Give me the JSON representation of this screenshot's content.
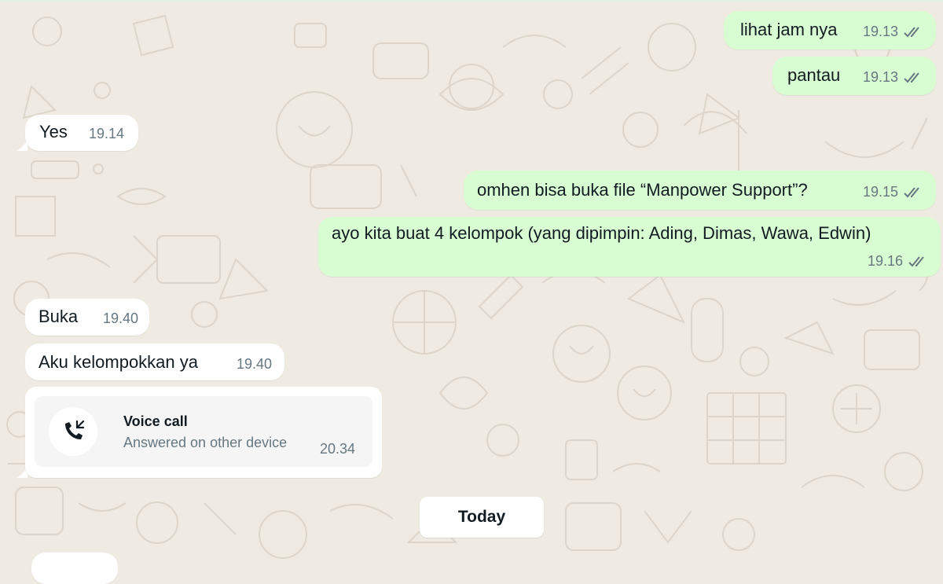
{
  "messages": [
    {
      "id": "m1",
      "direction": "outgoing",
      "text": "lihat jam nya",
      "time": "19.13",
      "status": "read"
    },
    {
      "id": "m2",
      "direction": "outgoing",
      "text": "pantau",
      "time": "19.13",
      "status": "read"
    },
    {
      "id": "m3",
      "direction": "incoming",
      "text": "Yes",
      "time": "19.14"
    },
    {
      "id": "m4",
      "direction": "outgoing",
      "text": "omhen bisa buka file “Manpower Support”?",
      "time": "19.15",
      "status": "read"
    },
    {
      "id": "m5",
      "direction": "outgoing",
      "text": "ayo kita buat 4 kelompok (yang dipimpin: Ading, Dimas, Wawa, Edwin)",
      "time": "19.16",
      "status": "read"
    },
    {
      "id": "m6",
      "direction": "incoming",
      "text": "Buka",
      "time": "19.40"
    },
    {
      "id": "m7",
      "direction": "incoming",
      "text": "Aku kelompokkan ya",
      "time": "19.40"
    }
  ],
  "call": {
    "title": "Voice call",
    "subtitle": "Answered on other device",
    "time": "20.34",
    "icon": "incoming-call-icon"
  },
  "date_separator": "Today",
  "colors": {
    "background": "#efeae2",
    "outgoing_bubble": "#d9fdd3",
    "incoming_bubble": "#ffffff",
    "read_ticks": "#667781",
    "doodle": "#d8d0c4"
  }
}
